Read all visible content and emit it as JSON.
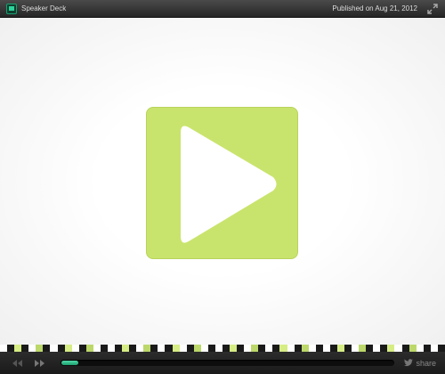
{
  "header": {
    "brand": "Speaker Deck",
    "published": "Published on Aug 21, 2012",
    "expand_icon": "expand-icon",
    "logo_icon": "speakerdeck-logo-icon"
  },
  "player": {
    "play_icon": "play-icon",
    "accent_color": "#c9e46d"
  },
  "controls": {
    "prev_icon": "rewind-icon",
    "next_icon": "fast-forward-icon",
    "progress": 0.05,
    "share_label": "share",
    "share_icon": "twitter-bird-icon",
    "progress_color": "#3ccf98"
  },
  "slide_strip_colors": [
    "#ffffff",
    "#d6ec85",
    "#1a1a1a",
    "#bcd86a"
  ]
}
